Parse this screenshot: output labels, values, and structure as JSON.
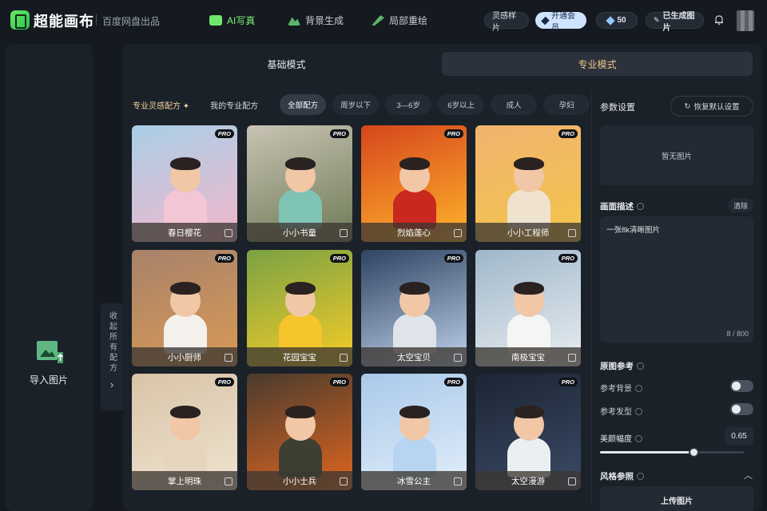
{
  "header": {
    "brand": "超能画布",
    "subtitle": "百度网盘出品",
    "nav": [
      {
        "label": "AI写真",
        "active": true
      },
      {
        "label": "背景生成",
        "active": false
      },
      {
        "label": "局部重绘",
        "active": false
      }
    ],
    "samples_label": "灵感样片",
    "vip_label": "开通会员",
    "credits": "50",
    "generated_label": "已生成图片"
  },
  "left_panel": {
    "import_label": "导入图片"
  },
  "collapse": {
    "label": "收起所有配方"
  },
  "modes": {
    "basic": "基础模式",
    "pro": "专业模式",
    "active": "pro"
  },
  "filters": {
    "inspiration": "专业灵感配方",
    "my_recipes": "我的专业配方",
    "chips": [
      "全部配方",
      "周岁以下",
      "3—6岁",
      "6岁以上",
      "成人",
      "孕妇"
    ],
    "active_chip": "全部配方"
  },
  "badge": "PRO",
  "cards": [
    {
      "title": "春日樱花",
      "bg": "#a9cfe6",
      "accent": "#f3b6cc",
      "outfit": "#f3c6d6"
    },
    {
      "title": "小小书童",
      "bg": "#c9c3b4",
      "accent": "#6d7a55",
      "outfit": "#7fc3b5"
    },
    {
      "title": "烈焰莲心",
      "bg": "#d6461c",
      "accent": "#ffb32b",
      "outfit": "#c8281e"
    },
    {
      "title": "小小工程师",
      "bg": "#f1b370",
      "accent": "#f3c54a",
      "outfit": "#efe3cf"
    },
    {
      "title": "小小厨师",
      "bg": "#a8826b",
      "accent": "#d89a55",
      "outfit": "#f4f1ec"
    },
    {
      "title": "花园宝宝",
      "bg": "#7aa244",
      "accent": "#f6cc27",
      "outfit": "#f5c52b"
    },
    {
      "title": "太空宝贝",
      "bg": "#2f4262",
      "accent": "#bfd3ec",
      "outfit": "#dfe4ea"
    },
    {
      "title": "南极宝宝",
      "bg": "#9fb7c9",
      "accent": "#e9eef2",
      "outfit": "#f5f5f3"
    },
    {
      "title": "掌上明珠",
      "bg": "#d9c4a8",
      "accent": "#efe3d0",
      "outfit": "#e7d6bf"
    },
    {
      "title": "小小士兵",
      "bg": "#4a3b2e",
      "accent": "#e0661f",
      "outfit": "#3d3f33"
    },
    {
      "title": "冰雪公主",
      "bg": "#a9c9ea",
      "accent": "#e3eefa",
      "outfit": "#b7d4f2"
    },
    {
      "title": "太空漫游",
      "bg": "#1c2534",
      "accent": "#3b4a66",
      "outfit": "#eceff2"
    }
  ],
  "params": {
    "title": "参数设置",
    "reset_label": "恢复默认设置",
    "no_image": "暂无图片",
    "desc_label": "画面描述",
    "clear_label": "清除",
    "desc_text": "一张8k清晰图片",
    "desc_count": "8 / 800",
    "ref_label": "原图参考",
    "ref_bg_label": "参考背景",
    "ref_hair_label": "参考发型",
    "beauty_label": "美颜幅度",
    "beauty_value": "0.65",
    "beauty_fraction": 0.65,
    "style_label": "风格参照",
    "upload_label": "上传图片"
  }
}
